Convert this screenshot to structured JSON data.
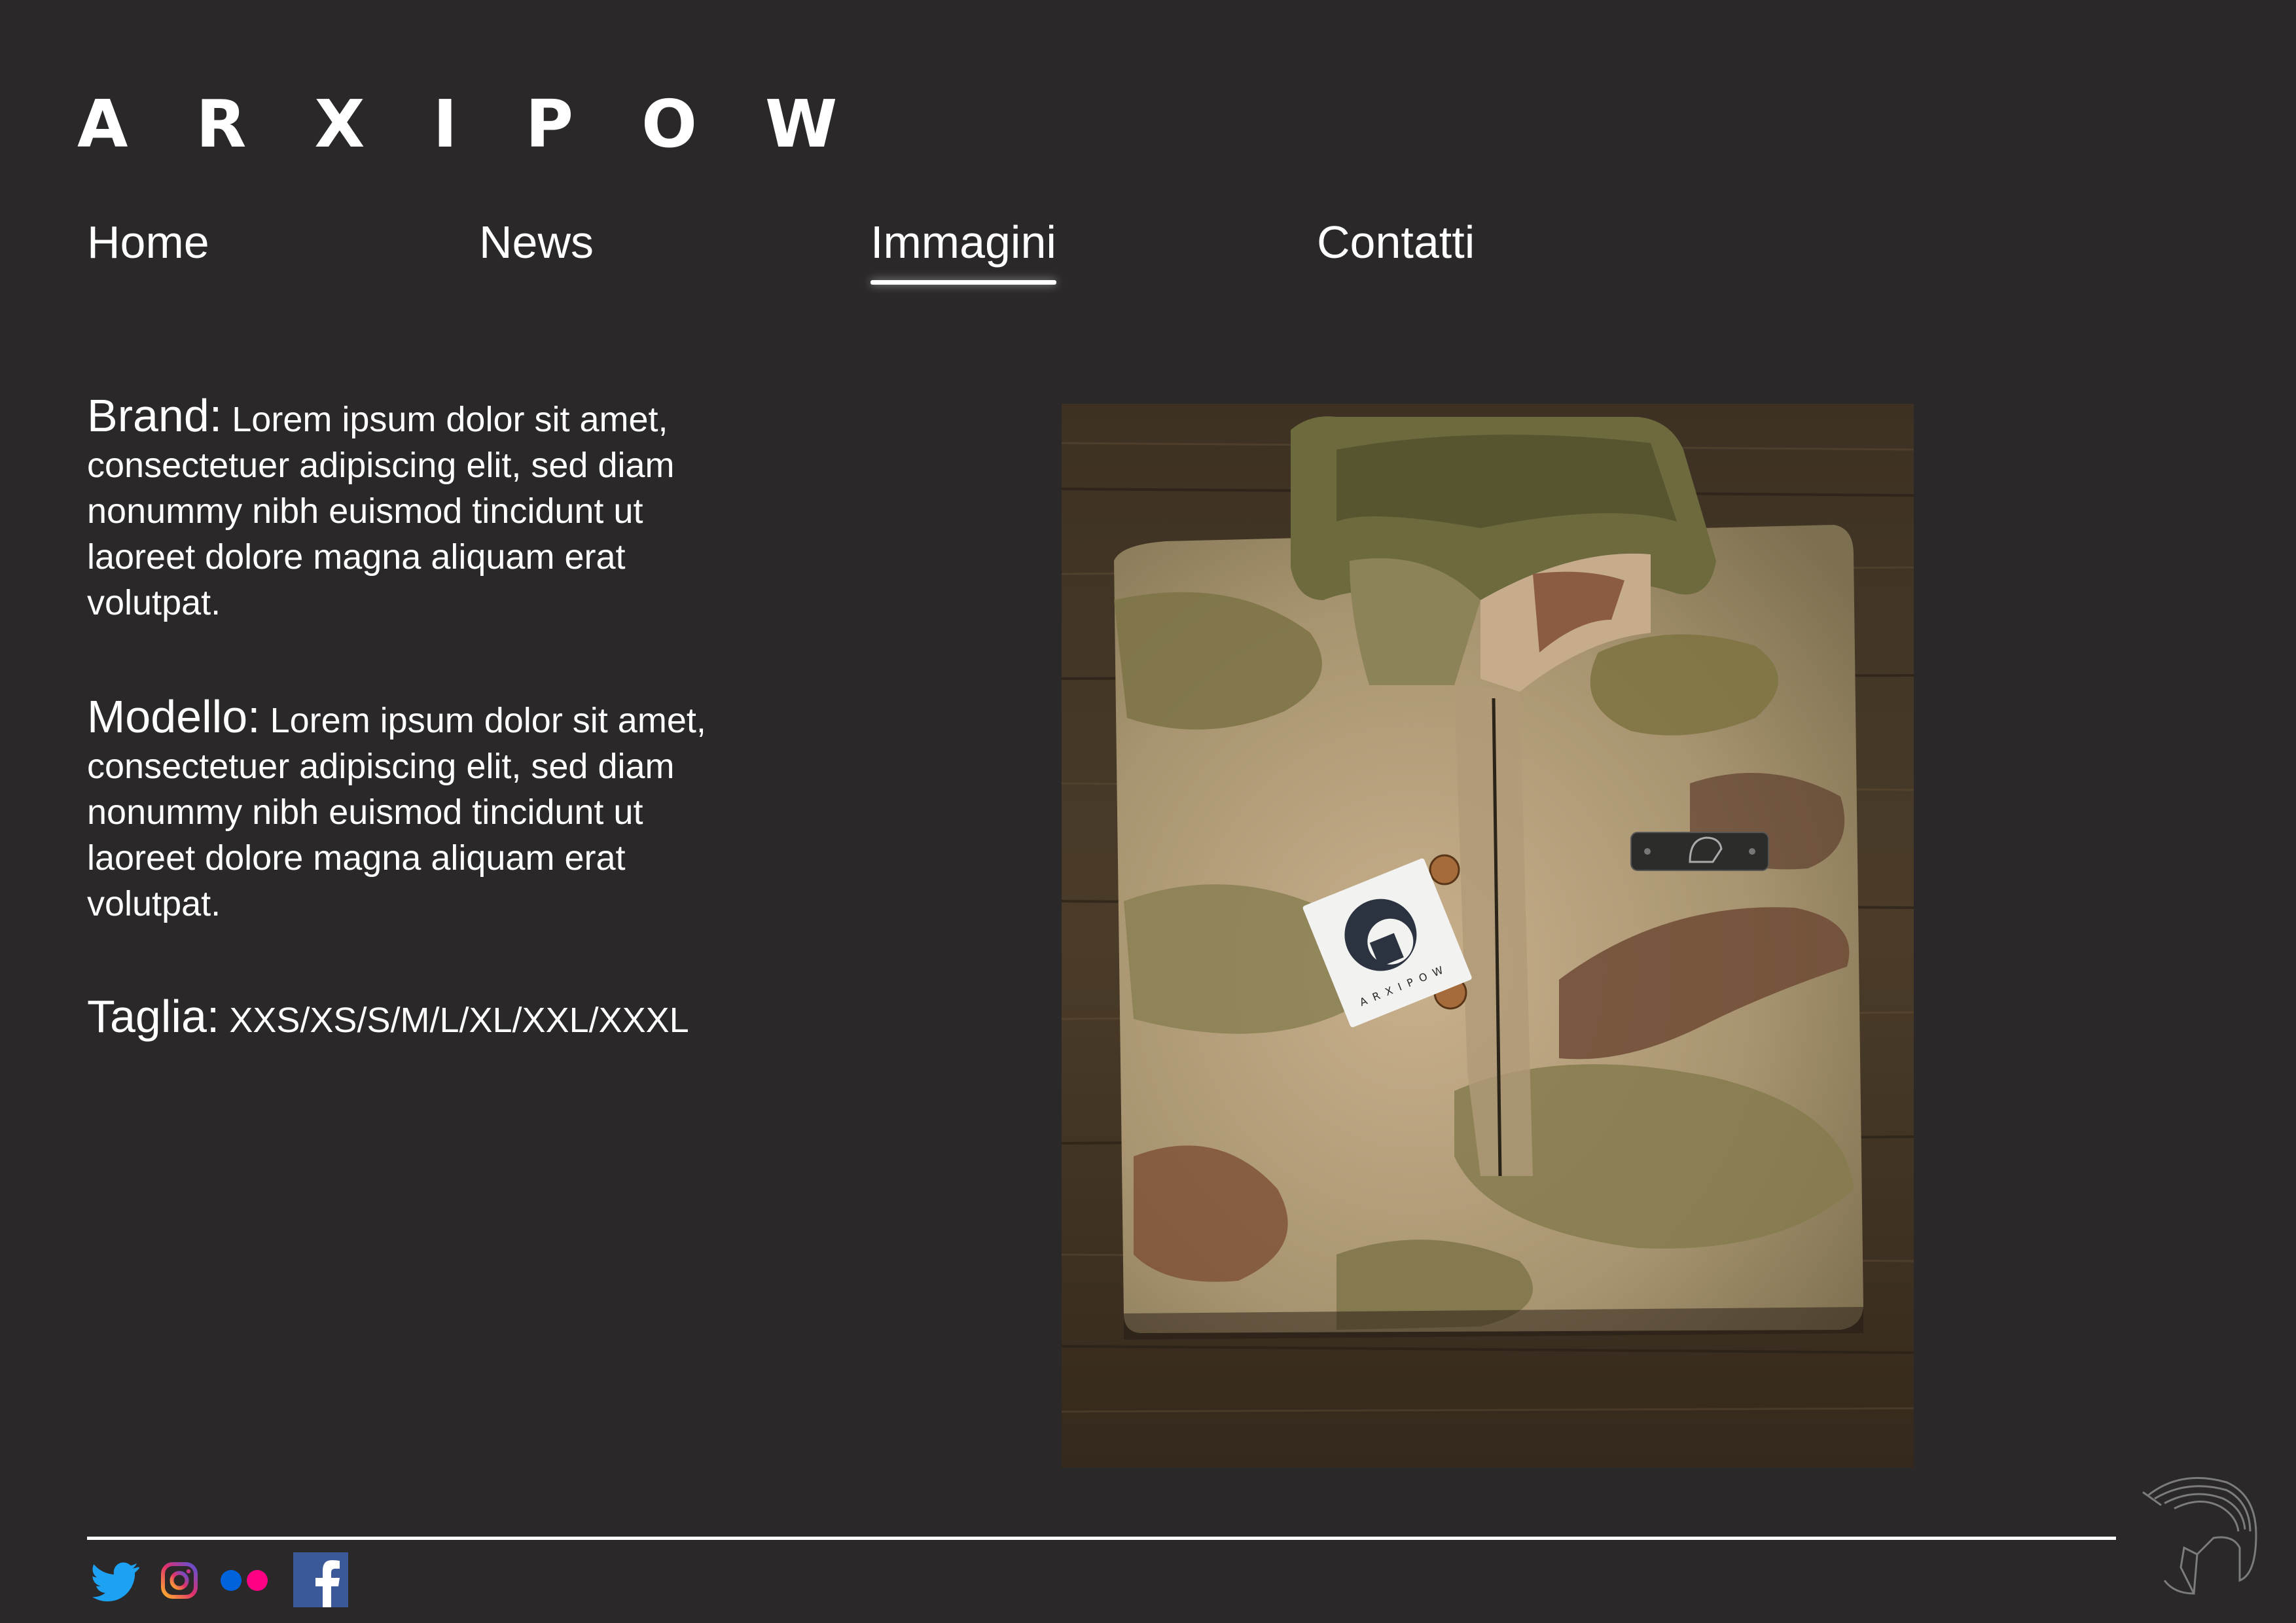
{
  "brand": {
    "logo_text": "ARXIPOW"
  },
  "nav": {
    "items": [
      {
        "label": "Home",
        "active": false
      },
      {
        "label": "News",
        "active": false
      },
      {
        "label": "Immagini",
        "active": true
      },
      {
        "label": "Contatti",
        "active": false
      }
    ]
  },
  "product": {
    "brand_label": "Brand:",
    "brand_text": "Lorem ipsum dolor sit amet, consectetuer adipiscing elit, sed diam nonummy nibh euismod tincidunt ut laoreet dolore magna aliquam erat volutpat.",
    "model_label": "Modello:",
    "model_text": "Lorem ipsum dolor sit amet, consectetuer adipiscing elit, sed diam nonummy nibh euismod tincidunt ut laoreet dolore magna aliquam erat volutpat.",
    "size_label": "Taglia:",
    "size_text": "XXS/XS/S/M/L/XL/XXL/XXXL",
    "photo_tag_text": "ARXIPOW"
  },
  "footer": {
    "social_icons": [
      "twitter-icon",
      "instagram-icon",
      "flickr-icon",
      "facebook-icon"
    ]
  },
  "colors": {
    "background": "#2a2829",
    "text": "#ffffff",
    "twitter": "#1da1f2",
    "flickr_blue": "#0063dc",
    "flickr_pink": "#ff0084",
    "facebook": "#3b5998"
  }
}
